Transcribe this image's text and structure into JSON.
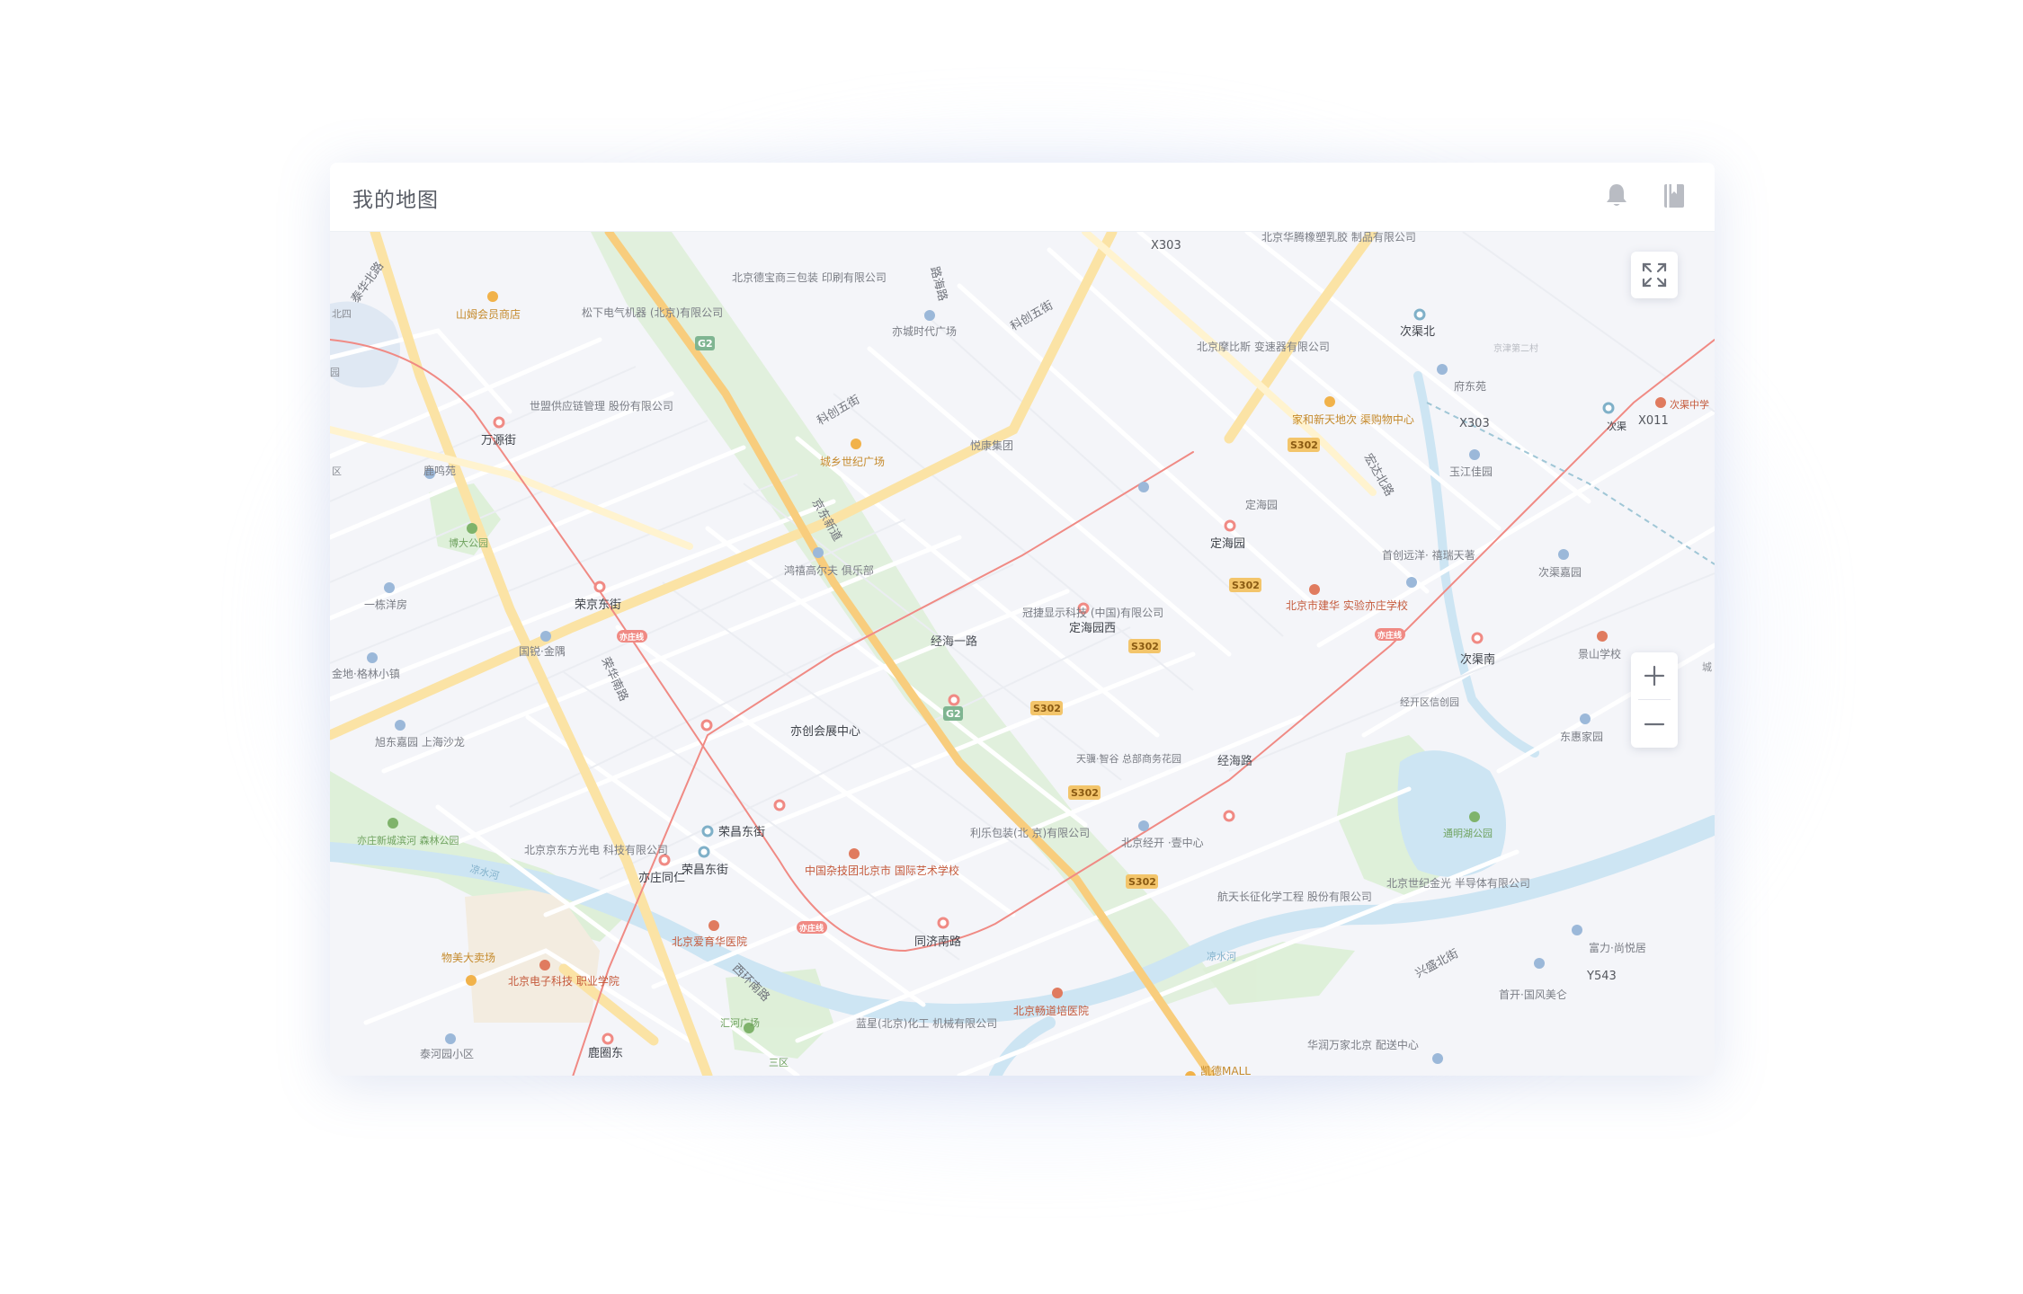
{
  "header": {
    "title": "我的地图",
    "icons": [
      "bell-icon",
      "book-icon"
    ]
  },
  "map_controls": {
    "fullscreen_icon": "expand-icon",
    "zoom_in_icon": "plus-icon",
    "zoom_out_icon": "minus-icon"
  },
  "map": {
    "road_labels": [
      "泰华北路",
      "科创五街",
      "科创五街",
      "京东新道",
      "经海一路",
      "经海路",
      "荣华南路",
      "西环南路",
      "兴盛北街",
      "宏达北路",
      "路海路",
      "凉水河",
      "凉水河"
    ],
    "badges": [
      "G2",
      "G2",
      "S302",
      "S302",
      "S302",
      "S302",
      "S302",
      "S302",
      "亦庄线",
      "亦庄线",
      "亦庄线"
    ],
    "stations": [
      "万源街",
      "荣京东街",
      "荣昌东街",
      "荣昌东街",
      "亦创会展中心",
      "经海一路",
      "定海园西",
      "定海园",
      "经海路",
      "同济南路",
      "亦庄同仁",
      "鹿圈东",
      "次渠南",
      "次渠",
      "次渠北"
    ],
    "pois": [
      "山姆会员商店",
      "松下电气机器 (北京)有限公司",
      "北京德宝商三包装 印刷有限公司",
      "亦城时代广场",
      "世盟供应链管理 股份有限公司",
      "城乡世纪广场",
      "悦康集团",
      "北京摩比斯 变速器有限公司",
      "北京华腾橡塑乳胶 制品有限公司",
      "家和新天地次 渠购物中心",
      "府东苑",
      "玉江佳园",
      "鹿鸣苑",
      "一栋洋房",
      "博大公园",
      "金地·格林小镇",
      "国锐·金隅",
      "旭东嘉园 上海沙龙",
      "鸿禧高尔夫 俱乐部",
      "冠捷显示科技 (中国)有限公司",
      "定海园",
      "北京市建华 实验亦庄学校",
      "首创远洋· 禧瑞天著",
      "次渠嘉园",
      "景山学校",
      "经开区信创园",
      "东惠家园",
      "通明湖公园",
      "天骥·智谷 总部商务花园",
      "利乐包装(北 京)有限公司",
      "北京经开 ·壹中心",
      "航天长征化学工程 股份有限公司",
      "北京世纪金光 半导体有限公司",
      "富力·尚悦居",
      "首开·国风美仑",
      "亦庄新城滨河 森林公园",
      "北京京东方光电 科技有限公司",
      "中国杂技团北京市 国际艺术学校",
      "北京爱育华医院",
      "物美大卖场",
      "北京电子科技 职业学院",
      "汇河广场",
      "三区",
      "泰河园小区",
      "蓝星(北京)化工 机械有限公司",
      "北京畅道培医院",
      "华润万家北京 配送中心",
      "凯德MALL"
    ],
    "highway_codes": [
      "X303",
      "X303",
      "X011",
      "Y543"
    ],
    "edge_labels": [
      "北四",
      "园",
      "区",
      "城",
      "次渠中学",
      "京津第二村"
    ],
    "colors": {
      "background": "#f4f5f9",
      "road_major": "#fbe3a5",
      "road_minor": "#ffffff",
      "green": "#dcefd5",
      "water": "#cde5f3",
      "metro": "#f08a84",
      "badge": "#f3c56b",
      "text": "#6f727a"
    }
  }
}
